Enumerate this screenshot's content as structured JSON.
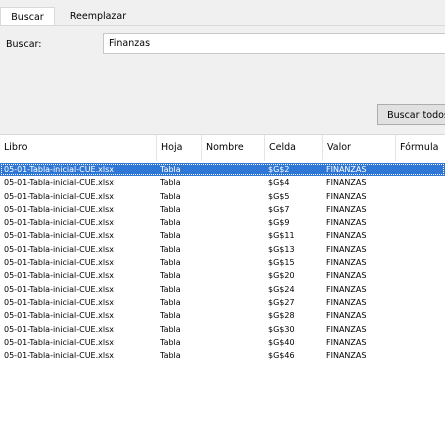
{
  "tabs": [
    {
      "label": "Buscar"
    },
    {
      "label": "Reemplazar"
    }
  ],
  "search": {
    "label": "Buscar:",
    "value": "Finanzas"
  },
  "find_all_label": "Buscar todos",
  "columns": {
    "libro": "Libro",
    "hoja": "Hoja",
    "nombre": "Nombre",
    "celda": "Celda",
    "valor": "Valor",
    "formula": "Fórmula"
  },
  "results": [
    {
      "libro": "05-01-Tabla-inicial-CUE.xlsx",
      "hoja": "Tabla",
      "nombre": "",
      "celda": "$G$2",
      "valor": "FINANZAS",
      "formula": ""
    },
    {
      "libro": "05-01-Tabla-inicial-CUE.xlsx",
      "hoja": "Tabla",
      "nombre": "",
      "celda": "$G$4",
      "valor": "FINANZAS",
      "formula": ""
    },
    {
      "libro": "05-01-Tabla-inicial-CUE.xlsx",
      "hoja": "Tabla",
      "nombre": "",
      "celda": "$G$5",
      "valor": "FINANZAS",
      "formula": ""
    },
    {
      "libro": "05-01-Tabla-inicial-CUE.xlsx",
      "hoja": "Tabla",
      "nombre": "",
      "celda": "$G$7",
      "valor": "FINANZAS",
      "formula": ""
    },
    {
      "libro": "05-01-Tabla-inicial-CUE.xlsx",
      "hoja": "Tabla",
      "nombre": "",
      "celda": "$G$9",
      "valor": "FINANZAS",
      "formula": ""
    },
    {
      "libro": "05-01-Tabla-inicial-CUE.xlsx",
      "hoja": "Tabla",
      "nombre": "",
      "celda": "$G$11",
      "valor": "FINANZAS",
      "formula": ""
    },
    {
      "libro": "05-01-Tabla-inicial-CUE.xlsx",
      "hoja": "Tabla",
      "nombre": "",
      "celda": "$G$13",
      "valor": "FINANZAS",
      "formula": ""
    },
    {
      "libro": "05-01-Tabla-inicial-CUE.xlsx",
      "hoja": "Tabla",
      "nombre": "",
      "celda": "$G$15",
      "valor": "FINANZAS",
      "formula": ""
    },
    {
      "libro": "05-01-Tabla-inicial-CUE.xlsx",
      "hoja": "Tabla",
      "nombre": "",
      "celda": "$G$20",
      "valor": "FINANZAS",
      "formula": ""
    },
    {
      "libro": "05-01-Tabla-inicial-CUE.xlsx",
      "hoja": "Tabla",
      "nombre": "",
      "celda": "$G$24",
      "valor": "FINANZAS",
      "formula": ""
    },
    {
      "libro": "05-01-Tabla-inicial-CUE.xlsx",
      "hoja": "Tabla",
      "nombre": "",
      "celda": "$G$27",
      "valor": "FINANZAS",
      "formula": ""
    },
    {
      "libro": "05-01-Tabla-inicial-CUE.xlsx",
      "hoja": "Tabla",
      "nombre": "",
      "celda": "$G$28",
      "valor": "FINANZAS",
      "formula": ""
    },
    {
      "libro": "05-01-Tabla-inicial-CUE.xlsx",
      "hoja": "Tabla",
      "nombre": "",
      "celda": "$G$30",
      "valor": "FINANZAS",
      "formula": ""
    },
    {
      "libro": "05-01-Tabla-inicial-CUE.xlsx",
      "hoja": "Tabla",
      "nombre": "",
      "celda": "$G$40",
      "valor": "FINANZAS",
      "formula": ""
    },
    {
      "libro": "05-01-Tabla-inicial-CUE.xlsx",
      "hoja": "Tabla",
      "nombre": "",
      "celda": "$G$46",
      "valor": "FINANZAS",
      "formula": ""
    }
  ],
  "selected_row": 0,
  "colors": {
    "selection": "#2f77d6",
    "dialog_bg": "#f0f0f0"
  }
}
